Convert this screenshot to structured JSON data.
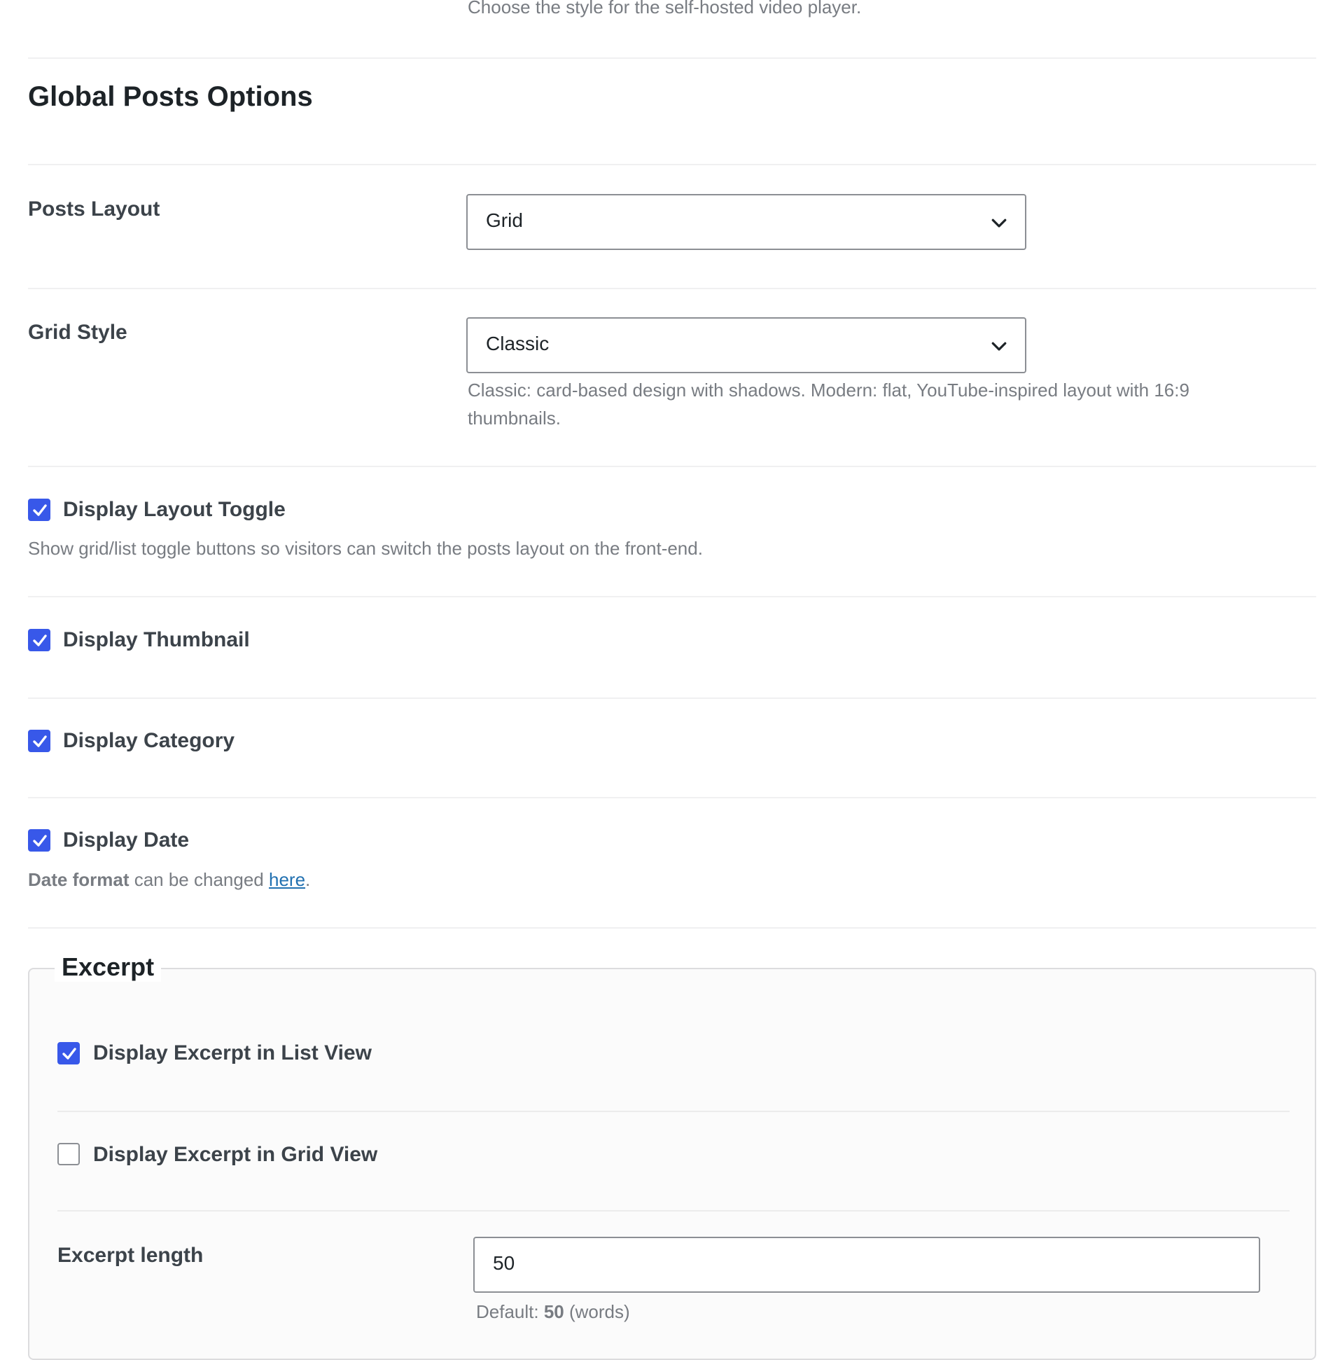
{
  "top_description": "Choose the style for the self-hosted video player.",
  "section_title": "Global Posts Options",
  "posts_layout": {
    "label": "Posts Layout",
    "value": "Grid"
  },
  "grid_style": {
    "label": "Grid Style",
    "value": "Classic",
    "description_line1": "Classic: card-based design with shadows. Modern: flat, YouTube-inspired layout with 16:9",
    "description_line2": "thumbnails."
  },
  "display_layout_toggle": {
    "label": "Display Layout Toggle",
    "checked": true,
    "description": "Show grid/list toggle buttons so visitors can switch the posts layout on the front-end."
  },
  "display_thumbnail": {
    "label": "Display Thumbnail",
    "checked": true
  },
  "display_category": {
    "label": "Display Category",
    "checked": true
  },
  "display_date": {
    "label": "Display Date",
    "checked": true,
    "desc_strong": "Date format",
    "desc_middle": " can be changed ",
    "desc_link": "here",
    "desc_end": "."
  },
  "excerpt": {
    "legend": "Excerpt",
    "list_view": {
      "label": "Display Excerpt in List View",
      "checked": true
    },
    "grid_view": {
      "label": "Display Excerpt in Grid View",
      "checked": false
    },
    "length": {
      "label": "Excerpt length",
      "value": "50",
      "default_prefix": "Default: ",
      "default_value": "50",
      "default_suffix": " (words)"
    }
  },
  "colors": {
    "checkbox_accent": "#3858e9",
    "link": "#2271b1",
    "label_text": "#3c434a",
    "description_text": "#787c82"
  },
  "icons": {
    "select_arrow": "chevron-down-icon",
    "checkbox_mark": "checkmark-icon"
  }
}
